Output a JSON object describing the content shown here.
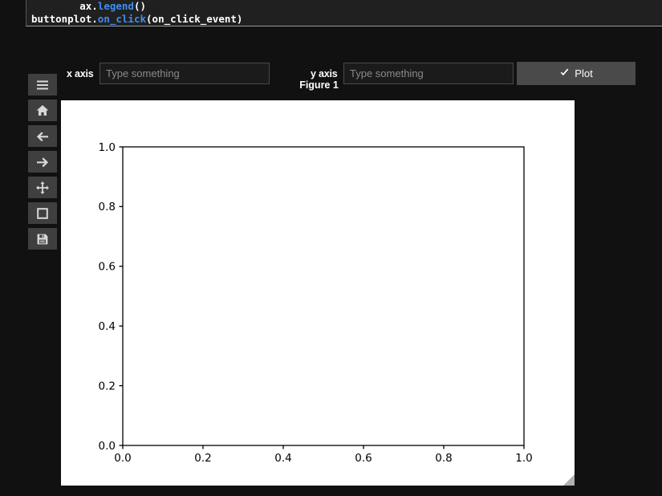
{
  "code_panel": {
    "lines": [
      {
        "indent": "        ",
        "pre": "ax.",
        "fn": "legend",
        "post": "()"
      },
      {
        "indent": "",
        "pre": "buttonplot.",
        "fn": "on_click",
        "post": "(on_click_event)"
      }
    ],
    "line1_indent": "        ",
    "line1_pre": "ax.",
    "line1_fn": "legend",
    "line1_post": "()",
    "line2_indent": "",
    "line2_pre": "buttonplot.",
    "line2_fn": "on_click",
    "line2_post": "(on_click_event)"
  },
  "controls": {
    "x_axis_label": "x axis",
    "x_axis_value": "",
    "x_axis_placeholder": "Type something",
    "y_axis_label": "y axis",
    "y_axis_value": "",
    "y_axis_placeholder": "Type something",
    "plot_button_label": "Plot",
    "plot_button_icon": "check-icon"
  },
  "toolbar": {
    "buttons": [
      {
        "name": "menu-icon",
        "title": "Menu"
      },
      {
        "name": "home-icon",
        "title": "Home"
      },
      {
        "name": "arrow-left-icon",
        "title": "Back"
      },
      {
        "name": "arrow-right-icon",
        "title": "Forward"
      },
      {
        "name": "pan-move-icon",
        "title": "Pan"
      },
      {
        "name": "zoom-rect-icon",
        "title": "Zoom to rectangle"
      },
      {
        "name": "save-floppy-icon",
        "title": "Save"
      }
    ]
  },
  "figure": {
    "title": "Figure 1"
  },
  "chart_data": {
    "type": "line",
    "title": "",
    "xlabel": "",
    "ylabel": "",
    "xlim": [
      0.0,
      1.0
    ],
    "ylim": [
      0.0,
      1.0
    ],
    "xticks": [
      "0.0",
      "0.2",
      "0.4",
      "0.6",
      "0.8",
      "1.0"
    ],
    "yticks": [
      "0.0",
      "0.2",
      "0.4",
      "0.6",
      "0.8",
      "1.0"
    ],
    "grid": false,
    "legend": null,
    "series": [],
    "note": "empty axes — no data plotted"
  },
  "colors": {
    "page_background": "#111111",
    "code_panel_background": "#202020",
    "code_keyword": "#3d8ff0",
    "code_text": "#ffffff",
    "button_background": "#4a4a4a",
    "toolbar_button_background": "#3f3f3f",
    "input_background": "#1b1b1b",
    "input_border": "#4a4a4a",
    "placeholder_text": "#8a8a8a",
    "figure_background": "#ffffff",
    "axes_line": "#000000"
  }
}
